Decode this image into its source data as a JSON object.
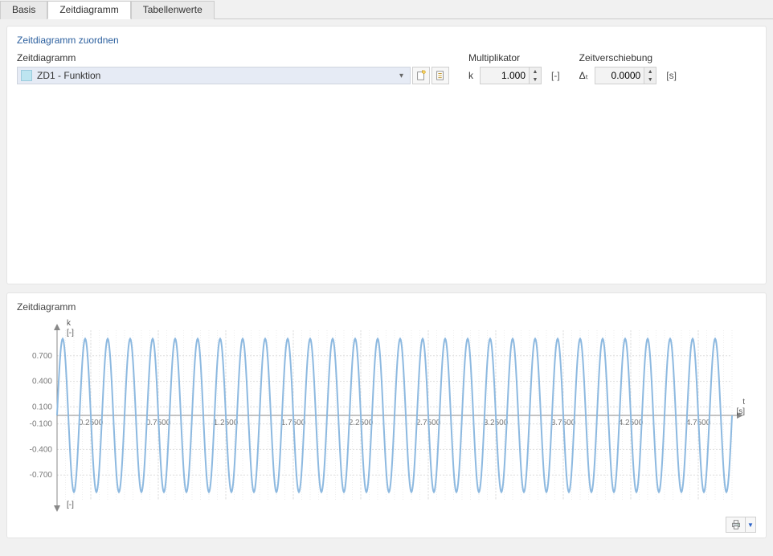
{
  "tabs": [
    {
      "label": "Basis",
      "active": false
    },
    {
      "label": "Zeitdiagramm",
      "active": true
    },
    {
      "label": "Tabellenwerte",
      "active": false
    }
  ],
  "assign": {
    "title": "Zeitdiagramm zuordnen",
    "dropdown_label": "Zeitdiagramm",
    "dropdown_value": "ZD1 - Funktion",
    "multiplikator_label": "Multiplikator",
    "multiplikator_symbol": "k",
    "multiplikator_value": "1.000",
    "multiplikator_unit": "[-]",
    "zeitverschiebung_label": "Zeitverschiebung",
    "zeitverschiebung_symbol": "Δₜ",
    "zeitverschiebung_value": "0.0000",
    "zeitverschiebung_unit": "[s]"
  },
  "chart_panel_title": "Zeitdiagramm",
  "chart_data": {
    "type": "line",
    "title": "",
    "y_axis_label_top": "k",
    "y_axis_unit_top": "[-]",
    "y_axis_unit_bottom": "[-]",
    "x_axis_label_right": "t",
    "x_axis_unit_right": "[s]",
    "x_range": [
      0,
      5.0
    ],
    "y_range": [
      -1.0,
      1.0
    ],
    "y_ticks": [
      0.7,
      0.4,
      0.1,
      -0.1,
      -0.4,
      -0.7
    ],
    "x_ticks": [
      0.25,
      0.75,
      1.25,
      1.75,
      2.25,
      2.75,
      3.25,
      3.75,
      4.25,
      4.75
    ],
    "function": {
      "kind": "sine",
      "amplitude": 0.9,
      "frequency_hz": 6.0,
      "phase_s": 0.0
    }
  }
}
